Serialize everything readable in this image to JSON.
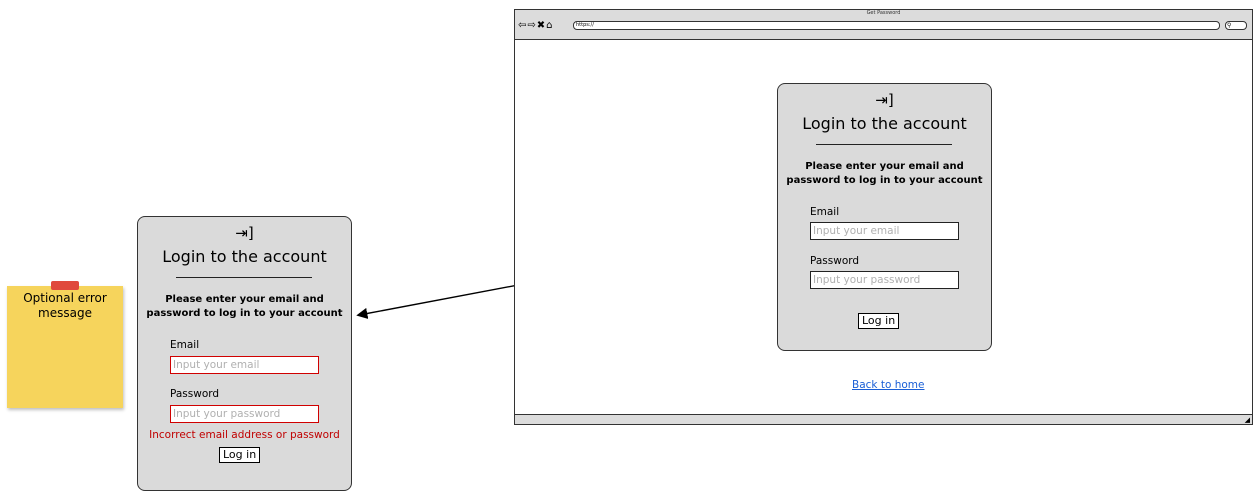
{
  "sticky_note": {
    "text": "Optional error message"
  },
  "login_card": {
    "icon": "login-icon",
    "title": "Login to the account",
    "description_line1": "Please enter your email and",
    "description_line2": "password to log in to your account",
    "email_label": "Email",
    "email_placeholder": "Input your email",
    "password_label": "Password",
    "password_placeholder": "Input your password",
    "login_button": "Log in"
  },
  "error_card": {
    "error_message": "Incorrect email address or password"
  },
  "browser": {
    "title": "Get Password",
    "url": "https://",
    "back_link": "Back to home"
  },
  "colors": {
    "card_bg": "#dadada",
    "error": "#c00000",
    "link": "#1a5fd6",
    "sticky": "#f6d45c"
  }
}
